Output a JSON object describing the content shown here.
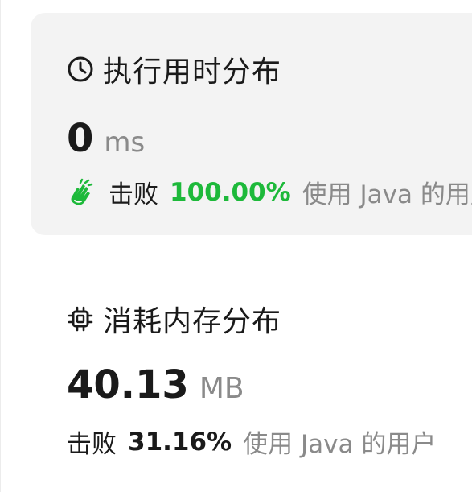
{
  "runtime": {
    "title": "执行用时分布",
    "value": "0",
    "unit": "ms",
    "beat_label": "击败",
    "percentile": "100.00%",
    "suffix": "使用 Java 的用户",
    "accent": "#1db93a",
    "icon": "clock-icon",
    "badge_icon": "clapping-hands-icon"
  },
  "memory": {
    "title": "消耗内存分布",
    "value": "40.13",
    "unit": "MB",
    "beat_label": "击败",
    "percentile": "31.16%",
    "suffix": "使用 Java 的用户",
    "icon": "chip-icon"
  }
}
